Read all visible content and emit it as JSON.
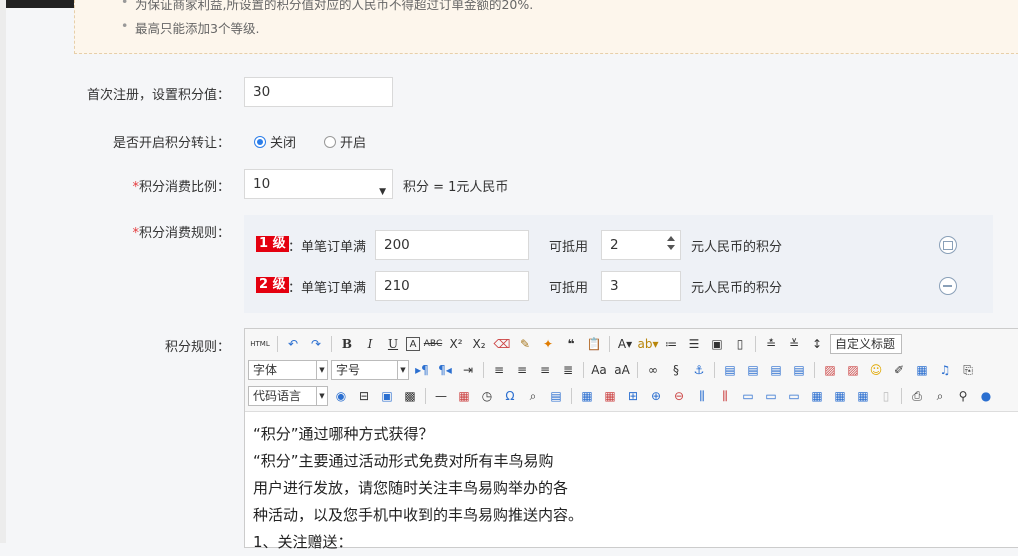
{
  "notice": {
    "items": [
      "为保证商家利益,所设置的积分值对应的人民币不得超过订单金额的20%.",
      "最高只能添加3个等级."
    ]
  },
  "first_register": {
    "label": "首次注册，设置积分值：",
    "value": "30"
  },
  "transfer": {
    "label": "是否开启积分转让：",
    "option_off": "关闭",
    "option_on": "开启",
    "selected": "关闭"
  },
  "ratio": {
    "star": "*",
    "label": "积分消费比例：",
    "value": "10",
    "suffix": "积分 = 1元人民币"
  },
  "rules": {
    "star": "*",
    "label": "积分消费规则：",
    "rows": [
      {
        "level": "1 级",
        "prefix": "：单笔订单满",
        "amount": "200",
        "deduct_label": "可抵用",
        "deduct": "2",
        "suffix": "元人民币的积分"
      },
      {
        "level": "2 级",
        "prefix": "：单笔订单满",
        "amount": "210",
        "deduct_label": "可抵用",
        "deduct": "3",
        "suffix": "元人民币的积分"
      }
    ]
  },
  "editor": {
    "label": "积分规则：",
    "html_btn": "HTML",
    "font_combo": "字体",
    "size_combo": "字号",
    "code_combo": "代码语言",
    "heading_combo": "自定义标题",
    "content": [
      "“积分”通过哪种方式获得？",
      "“积分”主要通过活动形式免费对所有丰鸟易购",
      "用户进行发放，请您随时关注丰鸟易购举办的各",
      "种活动，以及您手机中收到的丰鸟易购推送内容。",
      "1、关注赠送："
    ]
  },
  "colors": {
    "accent": "#2b7de9",
    "level_badge": "#e4000f",
    "required_star": "#e4393c",
    "notice_bg": "#fdf6ec",
    "rules_bg": "#eef1f6"
  }
}
